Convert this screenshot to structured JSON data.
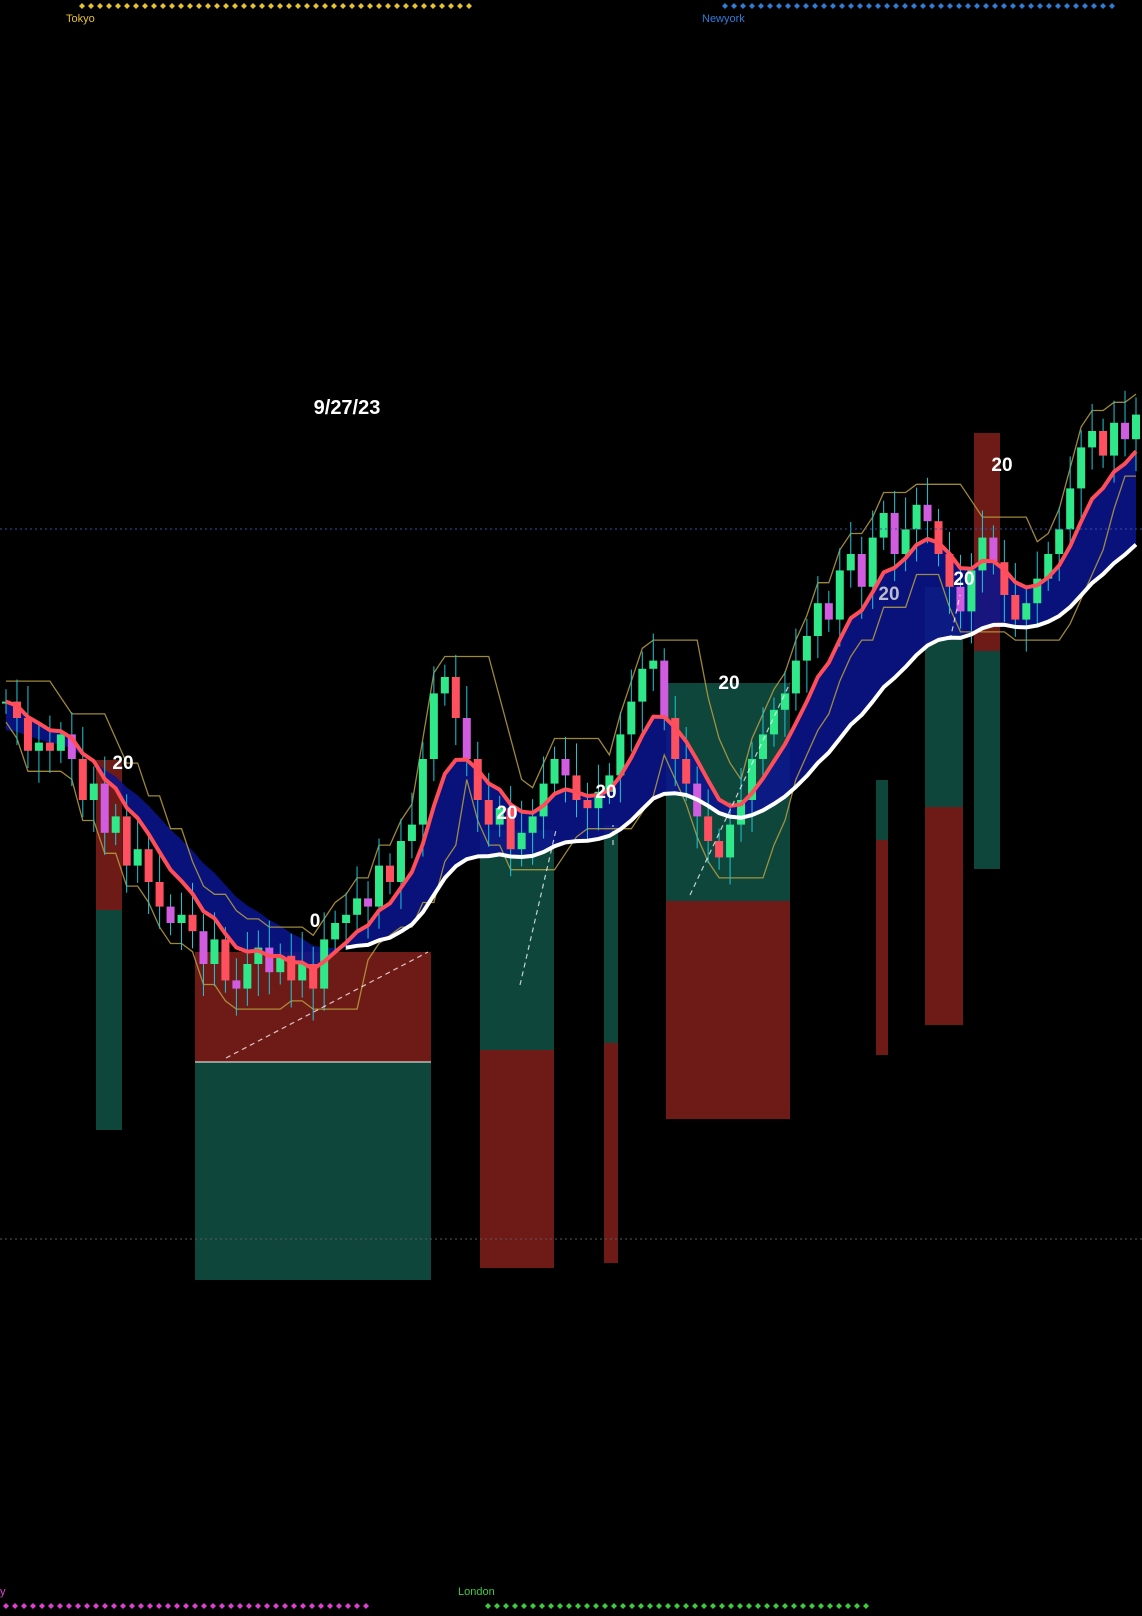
{
  "chart_data": {
    "type": "candlestick",
    "title": "",
    "date_label": "9/27/23",
    "colors": {
      "background": "#000000",
      "bull_candle": "#2ee88a",
      "bear_candle": "#ff5060",
      "bear_candle_alt": "#d05ce0",
      "fast_ma": "#ff4d5a",
      "slow_ma": "#ffffff",
      "cloud": "#0a1490",
      "envelope": "#b8a040",
      "profit_box": "#0f4a3e",
      "loss_box": "#7a1e1a",
      "tokyo": "#e6c22e",
      "newyork": "#2f7bd6",
      "sydney": "#e040d0",
      "london": "#3dcc3d"
    },
    "sessions": [
      {
        "name": "Tokyo",
        "color": "#e6c22e"
      },
      {
        "name": "Newyork",
        "color": "#2f7bd6"
      },
      {
        "name": "y",
        "color": "#e040d0"
      },
      {
        "name": "London",
        "color": "#3dcc3d"
      }
    ],
    "trade_labels": [
      "20",
      "0",
      "20",
      "20",
      "20",
      "20",
      "20",
      "20"
    ],
    "ohlc_close_path": [
      0.62,
      0.6,
      0.56,
      0.57,
      0.56,
      0.58,
      0.55,
      0.5,
      0.52,
      0.46,
      0.48,
      0.42,
      0.44,
      0.4,
      0.37,
      0.35,
      0.36,
      0.34,
      0.3,
      0.33,
      0.28,
      0.27,
      0.3,
      0.32,
      0.29,
      0.31,
      0.28,
      0.3,
      0.27,
      0.33,
      0.35,
      0.36,
      0.38,
      0.37,
      0.42,
      0.4,
      0.45,
      0.47,
      0.55,
      0.63,
      0.65,
      0.6,
      0.55,
      0.5,
      0.47,
      0.49,
      0.44,
      0.46,
      0.48,
      0.52,
      0.55,
      0.53,
      0.5,
      0.49,
      0.51,
      0.53,
      0.58,
      0.62,
      0.66,
      0.67,
      0.6,
      0.55,
      0.52,
      0.48,
      0.45,
      0.43,
      0.47,
      0.5,
      0.55,
      0.58,
      0.61,
      0.63,
      0.67,
      0.7,
      0.74,
      0.72,
      0.78,
      0.8,
      0.76,
      0.82,
      0.85,
      0.8,
      0.83,
      0.86,
      0.84,
      0.8,
      0.76,
      0.73,
      0.78,
      0.82,
      0.79,
      0.75,
      0.72,
      0.74,
      0.77,
      0.8,
      0.83,
      0.88,
      0.93,
      0.95,
      0.92,
      0.96,
      0.94,
      0.97
    ]
  }
}
